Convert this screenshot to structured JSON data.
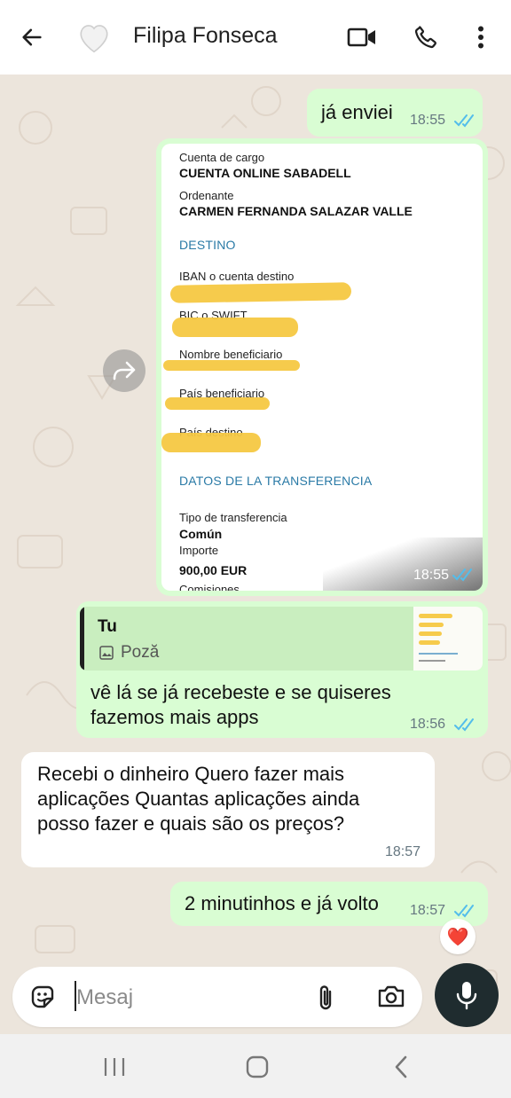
{
  "header": {
    "contact_name": "Filipa Fonseca",
    "back_icon": "arrow-left-icon",
    "avatar_icon": "heart-avatar-icon",
    "video_icon": "video-camera-icon",
    "call_icon": "phone-icon",
    "menu_icon": "more-vertical-icon"
  },
  "messages": {
    "m1": {
      "text": "já enviei",
      "time": "18:55",
      "status": "read"
    },
    "receipt": {
      "time": "18:55",
      "label_cuenta_cargo": "Cuenta de cargo",
      "value_cuenta_cargo": "CUENTA ONLINE SABADELL",
      "label_ordenante": "Ordenante",
      "value_ordenante": "CARMEN FERNANDA SALAZAR VALLE",
      "section_destino": "DESTINO",
      "label_iban": "IBAN o cuenta destino",
      "label_bic": "BIC o SWIFT",
      "label_nombre": "Nombre beneficiario",
      "label_pais_benef": "País beneficiario",
      "label_pais_dest": "País destino",
      "section_datos": "DATOS DE LA TRANSFERENCIA",
      "label_tipo": "Tipo de transferencia",
      "value_tipo": "Común",
      "label_importe": "Importe",
      "value_importe": "900,00 EUR",
      "label_comisiones": "Comisiones"
    },
    "m3": {
      "quote_author": "Tu",
      "quote_type": "Poză",
      "text_line1": "vê lá se já recebeste e se quiseres",
      "text_line2": "fazemos mais apps",
      "time": "18:56",
      "status": "read"
    },
    "m4": {
      "text_line1": "Recebi o dinheiro Quero fazer mais",
      "text_line2": "aplicações Quantas aplicações ainda",
      "text_line3": "posso fazer e quais são os preços?",
      "time": "18:57"
    },
    "m5": {
      "text": "2 minutinhos e já volto",
      "time": "18:57",
      "status": "read",
      "reaction": "❤️"
    }
  },
  "composer": {
    "placeholder": "Mesaj",
    "value": "",
    "emoji_icon": "sticker-icon",
    "attach_icon": "paperclip-icon",
    "camera_icon": "camera-icon",
    "mic_icon": "microphone-icon"
  },
  "navbar": {
    "recents_icon": "recents-icon",
    "home_icon": "home-icon",
    "back_icon": "nav-back-icon"
  },
  "colors": {
    "outgoing_bubble": "#d9fdd3",
    "incoming_bubble": "#ffffff",
    "read_ticks": "#53bdeb",
    "chat_background": "#ece5dc",
    "highlighter": "#f5c842"
  }
}
